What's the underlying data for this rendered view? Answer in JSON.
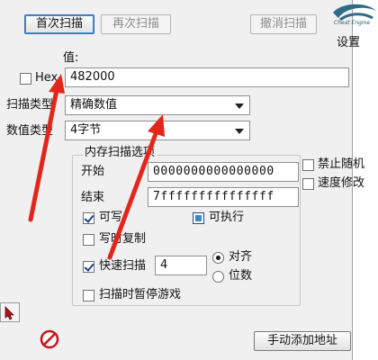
{
  "toolbar": {
    "first_scan": "首次扫描",
    "next_scan": "再次扫描",
    "undo_scan": "撤消扫描",
    "settings": "设置"
  },
  "value": {
    "label": "值:",
    "hex_label": "Hex",
    "hex_checked": false,
    "input": "482000"
  },
  "scan_type": {
    "label": "扫描类型",
    "selected": "精确数值"
  },
  "value_type": {
    "label": "数值类型",
    "selected": "4字节"
  },
  "mem_options": {
    "title": "内存扫描选项",
    "start_label": "开始",
    "start_value": "0000000000000000",
    "end_label": "结束",
    "end_value": "7fffffffffffffff",
    "writable": "可写",
    "writable_checked": true,
    "executable": "可执行",
    "executable_state": "indeterminate",
    "copy_on_write": "写时复制",
    "copy_on_write_checked": false,
    "fast_scan": "快速扫描",
    "fast_scan_checked": true,
    "fast_scan_value": "4",
    "align": "对齐",
    "align_selected": true,
    "last_digits": "位数",
    "last_digits_selected": false,
    "pause_game": "扫描时暂停游戏",
    "pause_game_checked": false
  },
  "right_options": {
    "disable_random": "禁止随机",
    "disable_random_checked": false,
    "speedhack": "速度修改",
    "speedhack_checked": false
  },
  "bottom": {
    "add_address": "手动添加地址"
  },
  "colors": {
    "annotation_arrow": "#e2261b",
    "panel_bg": "#f0f0f0",
    "logo": "#2f6b86"
  },
  "icons": {
    "logo": "cheat-engine-logo-icon",
    "pointer": "arrow-pointer-icon",
    "stop": "stop-sign-icon"
  }
}
